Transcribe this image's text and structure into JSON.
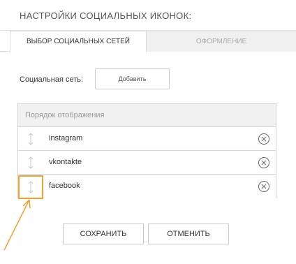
{
  "header": {
    "title": "НАСТРОЙКИ СОЦИАЛЬНЫХ ИКОНОК:"
  },
  "tabs": [
    {
      "label": "ВЫБОР СОЦИАЛЬНЫХ СЕТЕЙ",
      "active": true
    },
    {
      "label": "ОФОРМЛЕНИЕ",
      "active": false
    }
  ],
  "social": {
    "field_label": "Социальная сеть:",
    "add_label": "Добавить"
  },
  "list": {
    "header": "Порядок отображения",
    "items": [
      {
        "label": "instagram"
      },
      {
        "label": "vkontakte"
      },
      {
        "label": "facebook"
      }
    ]
  },
  "actions": {
    "save_label": "СОХРАНИТЬ",
    "cancel_label": "ОТМЕНИТЬ"
  },
  "colors": {
    "highlight": "#f0a030",
    "border": "#d6d6d6",
    "tab_inactive_bg": "#f0f0f0"
  },
  "icons": {
    "drag": "drag-handle-icon",
    "remove": "remove-circle-icon",
    "annotation": "annotation-arrow-icon"
  }
}
